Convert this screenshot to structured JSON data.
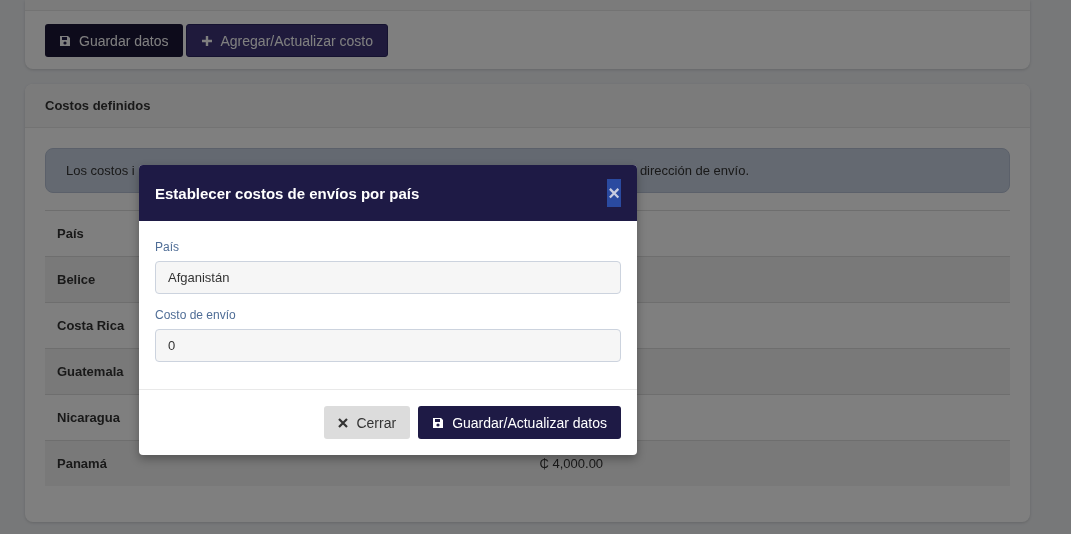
{
  "toolbar": {
    "buttons": [
      {
        "label": "Guardar datos",
        "kind": "save"
      },
      {
        "label": "Agregar/Actualizar costo",
        "kind": "add"
      }
    ]
  },
  "costs_card": {
    "title": "Costos definidos",
    "alert": {
      "text_start": "Los costos i",
      "text_end": "dirección de envío."
    },
    "table": {
      "columns": [
        "País"
      ],
      "rows": [
        {
          "country": "Belice"
        },
        {
          "country": "Costa Rica"
        },
        {
          "country": "Guatemala"
        },
        {
          "country": "Nicaragua"
        },
        {
          "country": "Panamá",
          "cost": "₵ 4,000.00"
        }
      ]
    }
  },
  "modal": {
    "title": "Establecer costos de envíos por país",
    "close": "×",
    "fields": [
      {
        "label": "País",
        "value": "Afganistán"
      },
      {
        "label": "Costo de envío",
        "value": "0"
      }
    ],
    "buttons": [
      {
        "label": "Cerrar",
        "kind": "close"
      },
      {
        "label": "Guardar/Actualizar datos",
        "kind": "save"
      }
    ]
  }
}
